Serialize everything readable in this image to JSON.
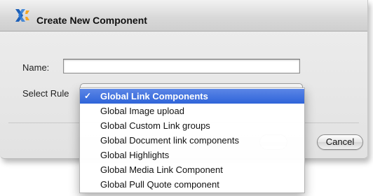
{
  "dialog": {
    "title": "Create New Component",
    "logo_icon": "x-logo-icon"
  },
  "form": {
    "name_label": "Name:",
    "name_value": "",
    "rule_label": "Select Rule"
  },
  "rule_menu": {
    "items": [
      {
        "label": "Global Link Components",
        "selected": true
      },
      {
        "label": "Global Image upload",
        "selected": false
      },
      {
        "label": "Global Custom Link groups",
        "selected": false
      },
      {
        "label": "Global Document link components",
        "selected": false
      },
      {
        "label": "Global Highlights",
        "selected": false
      },
      {
        "label": "Global Media Link Component",
        "selected": false
      },
      {
        "label": "Global Pull Quote component",
        "selected": false
      }
    ],
    "check_mark": "✓",
    "highlight_color": "#3a6fe0"
  },
  "buttons": {
    "cancel_label": "Cancel"
  }
}
